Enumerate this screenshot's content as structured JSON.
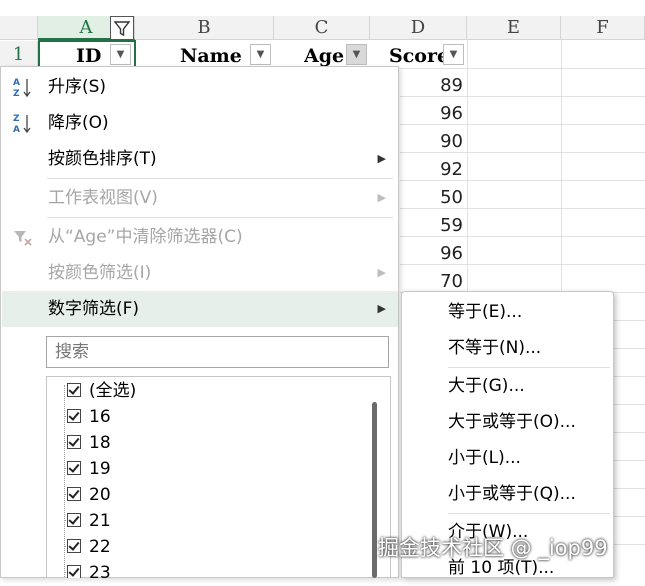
{
  "sheet": {
    "columns": [
      "A",
      "B",
      "C",
      "D",
      "E",
      "F"
    ],
    "row_numbers": [
      "1"
    ],
    "headers": {
      "id": "ID",
      "name": "Name",
      "age": "Age",
      "score": "Score"
    },
    "scores": [
      "89",
      "96",
      "90",
      "92",
      "50",
      "59",
      "96",
      "70"
    ]
  },
  "menu": {
    "sort_asc": "升序(S)",
    "sort_desc": "降序(O)",
    "sort_by_color": "按颜色排序(T)",
    "sheet_view": "工作表视图(V)",
    "clear_filter": "从“Age”中清除筛选器(C)",
    "filter_by_color": "按颜色筛选(I)",
    "number_filters": "数字筛选(F)",
    "search_placeholder": "搜索",
    "values": [
      "(全选)",
      "16",
      "18",
      "19",
      "20",
      "21",
      "22",
      "23"
    ]
  },
  "submenu": {
    "items": [
      "等于(E)...",
      "不等于(N)...",
      "大于(G)...",
      "大于或等于(O)...",
      "小于(L)...",
      "小于或等于(Q)...",
      "介于(W)...",
      "前 10 项(T)..."
    ]
  },
  "watermark": "掘金技术社区 @ _iop99",
  "colors": {
    "accent_green": "#217346",
    "hover": "#e6efe9"
  }
}
